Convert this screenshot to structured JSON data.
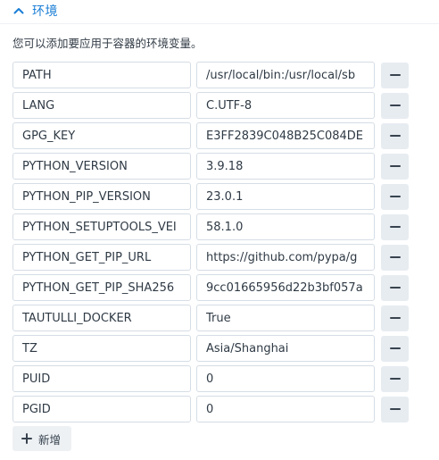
{
  "section": {
    "title": "环境",
    "icon": "chevron-up-icon",
    "accent_color": "#1a7ed6"
  },
  "description": "您可以添加要应用于容器的环境变量。",
  "env_vars": [
    {
      "key": "PATH",
      "value": "/usr/local/bin:/usr/local/sb"
    },
    {
      "key": "LANG",
      "value": "C.UTF-8"
    },
    {
      "key": "GPG_KEY",
      "value": "E3FF2839C048B25C084DE"
    },
    {
      "key": "PYTHON_VERSION",
      "value": "3.9.18"
    },
    {
      "key": "PYTHON_PIP_VERSION",
      "value": "23.0.1"
    },
    {
      "key": "PYTHON_SETUPTOOLS_VEI",
      "value": "58.1.0"
    },
    {
      "key": "PYTHON_GET_PIP_URL",
      "value": "https://github.com/pypa/g"
    },
    {
      "key": "PYTHON_GET_PIP_SHA256",
      "value": "9cc01665956d22b3bf057a"
    },
    {
      "key": "TAUTULLI_DOCKER",
      "value": "True"
    },
    {
      "key": "TZ",
      "value": "Asia/Shanghai"
    },
    {
      "key": "PUID",
      "value": "0"
    },
    {
      "key": "PGID",
      "value": "0"
    }
  ],
  "remove_icon": "minus-icon",
  "add_button": {
    "label": "新增",
    "icon": "plus-icon"
  }
}
